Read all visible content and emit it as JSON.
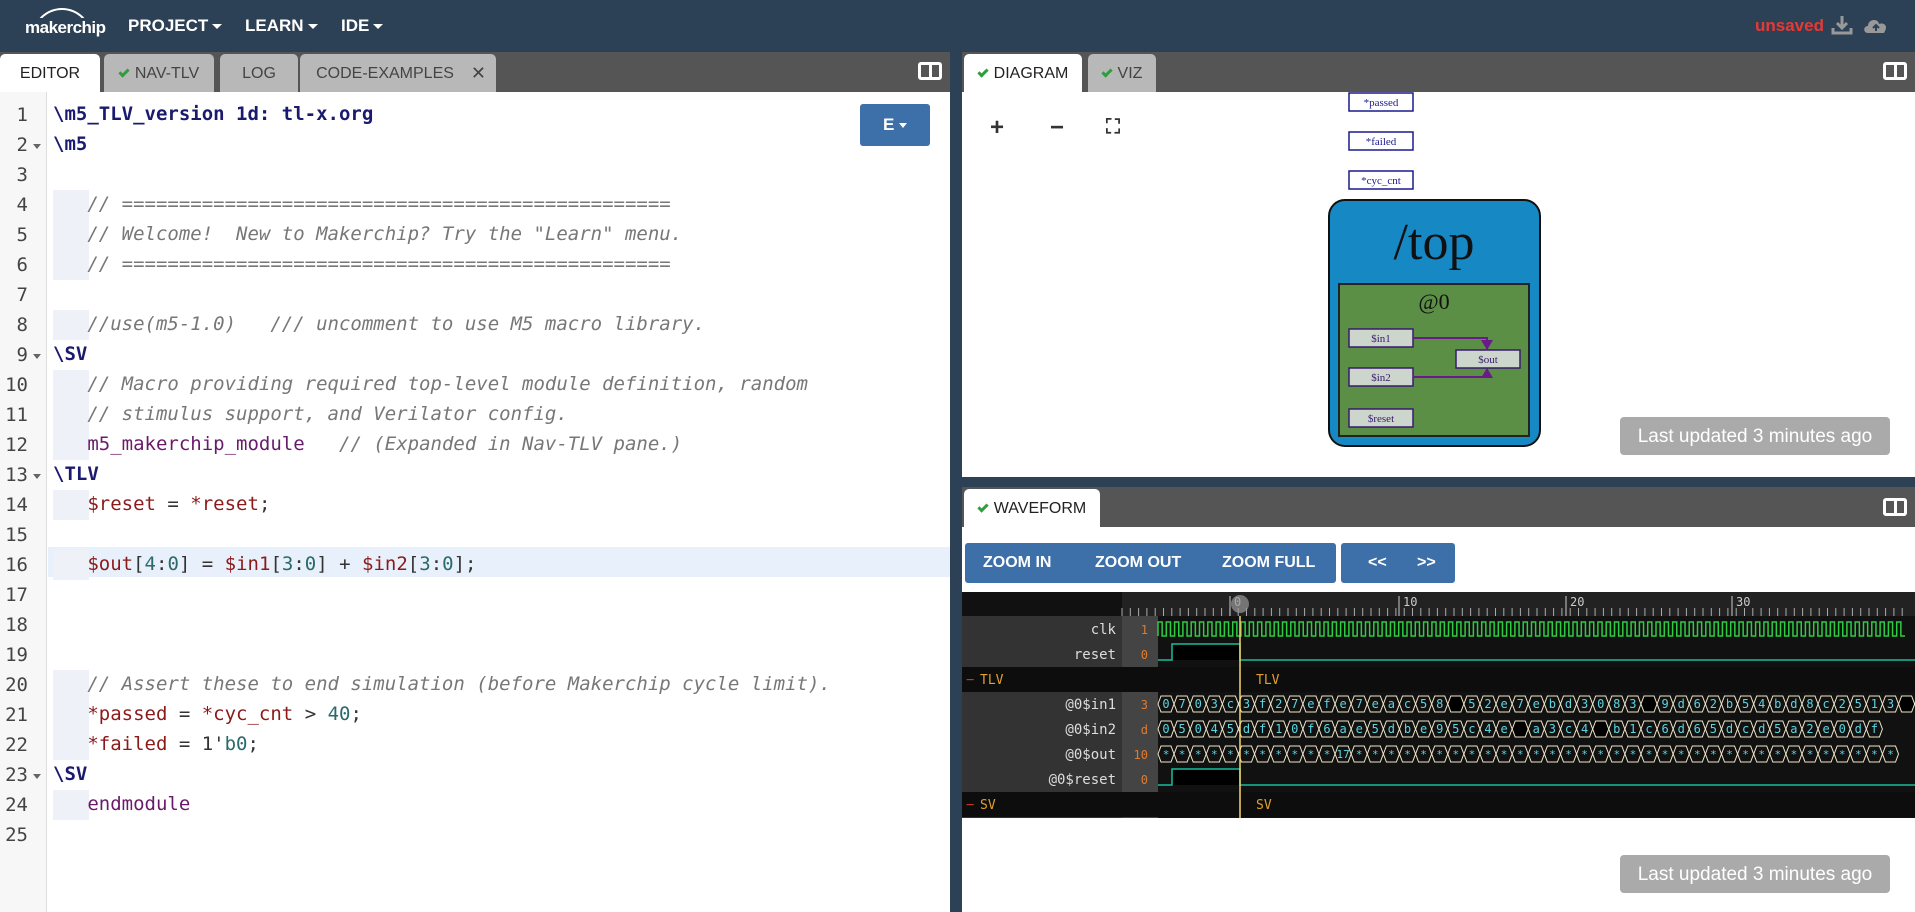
{
  "header": {
    "logo": "makerchip",
    "menus": [
      "PROJECT",
      "LEARN",
      "IDE"
    ],
    "status": "unsaved"
  },
  "editor_tabs": [
    {
      "label": "EDITOR",
      "active": true,
      "check": false,
      "close": false
    },
    {
      "label": "NAV-TLV",
      "active": false,
      "check": true,
      "close": false
    },
    {
      "label": "LOG",
      "active": false,
      "check": false,
      "close": false
    },
    {
      "label": "CODE-EXAMPLES",
      "active": false,
      "check": false,
      "close": true
    }
  ],
  "editor": {
    "mode_button": "E",
    "lines": [
      "\\m5_TLV_version 1d: tl-x.org",
      "\\m5",
      "",
      "   // ================================================",
      "   // Welcome!  New to Makerchip? Try the \"Learn\" menu.",
      "   // ================================================",
      "",
      "   //use(m5-1.0)   /// uncomment to use M5 macro library.",
      "\\SV",
      "   // Macro providing required top-level module definition, random",
      "   // stimulus support, and Verilator config.",
      "   m5_makerchip_module   // (Expanded in Nav-TLV pane.)",
      "\\TLV",
      "   $reset = *reset;",
      "",
      "   $out[4:0] = $in1[3:0] + $in2[3:0];",
      "",
      "",
      "",
      "   // Assert these to end simulation (before Makerchip cycle limit).",
      "   *passed = *cyc_cnt > 40;",
      "   *failed = 1'b0;",
      "\\SV",
      "   endmodule",
      ""
    ]
  },
  "diagram_tabs": [
    {
      "label": "DIAGRAM",
      "active": true,
      "check": true
    },
    {
      "label": "VIZ",
      "active": false,
      "check": true
    }
  ],
  "diagram": {
    "zoom_in": "+",
    "zoom_out": "−",
    "fit": "⛶",
    "signals_top": [
      "*passed",
      "*failed",
      "*cyc_cnt"
    ],
    "scope_title": "/top",
    "stage_title": "@0",
    "in1": "$in1",
    "in2": "$in2",
    "reset": "$reset",
    "out": "$out",
    "last_updated": "Last updated 3 minutes ago"
  },
  "waveform_tab": {
    "label": "WAVEFORM",
    "check": true
  },
  "waveform": {
    "buttons": [
      "ZOOM IN",
      "ZOOM OUT",
      "ZOOM FULL"
    ],
    "nav_buttons": [
      "<<",
      ">>"
    ],
    "ticks": [
      "0",
      "10",
      "20",
      "30"
    ],
    "rows": [
      {
        "name": "clk",
        "value": "1"
      },
      {
        "name": "reset",
        "value": "0"
      },
      {
        "name": "TLV",
        "value": "",
        "group": true
      },
      {
        "name": "@0$in1",
        "value": "3"
      },
      {
        "name": "@0$in2",
        "value": "d"
      },
      {
        "name": "@0$out",
        "value": "10"
      },
      {
        "name": "@0$reset",
        "value": "0"
      },
      {
        "name": "SV",
        "value": "",
        "group": true
      }
    ],
    "in1_values": "0703c3f27efe7eac58 52e7ebd3083 9d62b54bd8c2513 0",
    "in2_values": "05045df10f6ae5dbe95c4e a3c4 b1c6d65dcd5a2e0df",
    "out_marker": "17",
    "group_label_tlv": "TLV",
    "group_label_sv": "SV",
    "last_updated": "Last updated 3 minutes ago"
  }
}
